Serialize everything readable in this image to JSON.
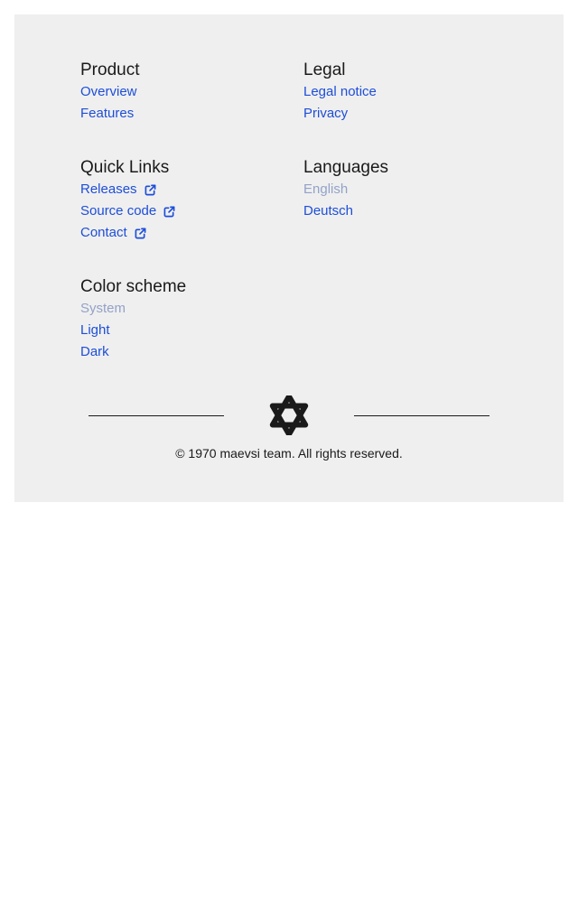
{
  "footer": {
    "sections": {
      "product": {
        "title": "Product",
        "links": [
          "Overview",
          "Features"
        ]
      },
      "legal": {
        "title": "Legal",
        "links": [
          "Legal notice",
          "Privacy"
        ]
      },
      "quick_links": {
        "title": "Quick Links",
        "links": [
          "Releases",
          "Source code",
          "Contact"
        ]
      },
      "languages": {
        "title": "Languages",
        "links": [
          "English",
          "Deutsch"
        ],
        "selected": "English"
      },
      "color_scheme": {
        "title": "Color scheme",
        "links": [
          "System",
          "Light",
          "Dark"
        ],
        "selected": "System"
      }
    },
    "logo_icon": "star-of-david-icon",
    "copyright": "© 1970 maevsi team. All rights reserved."
  },
  "colors": {
    "background": "#efefef",
    "link": "#1d4ed8",
    "link_active": "#93a2c8",
    "text": "#1a1a1a"
  }
}
